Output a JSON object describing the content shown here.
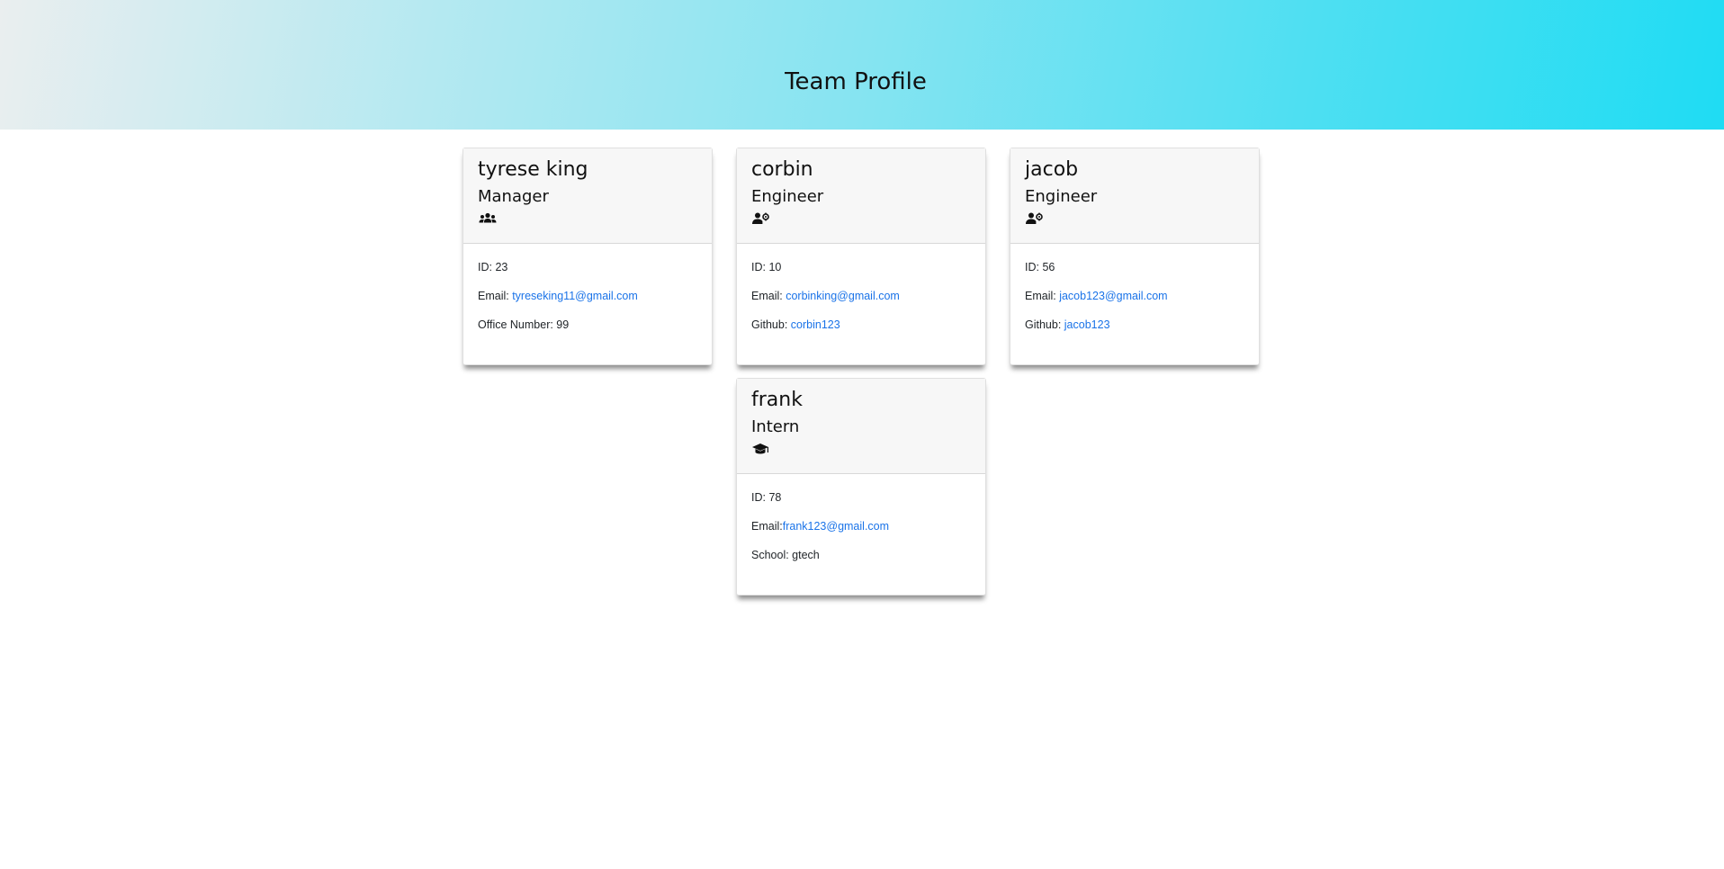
{
  "header": {
    "title": "Team Profile",
    "gradient_start": "#eaeeef",
    "gradient_end": "#1fdcf3"
  },
  "cards": [
    {
      "name": "tyrese king",
      "role": "Manager",
      "icon": "users-icon",
      "id_label": "ID: 23",
      "email_label": "Email: ",
      "email": "tyreseking11@gmail.com",
      "extra_label": "Office Number: 99",
      "extra_link": ""
    },
    {
      "name": "corbin",
      "role": "Engineer",
      "icon": "user-gear-icon",
      "id_label": "ID: 10",
      "email_label": "Email: ",
      "email": "corbinking@gmail.com",
      "extra_label": "Github: ",
      "extra_link": "corbin123"
    },
    {
      "name": "jacob",
      "role": "Engineer",
      "icon": "user-gear-icon",
      "id_label": "ID: 56",
      "email_label": "Email: ",
      "email": "jacob123@gmail.com",
      "extra_label": "Github: ",
      "extra_link": "jacob123"
    },
    {
      "name": "frank",
      "role": "Intern",
      "icon": "graduation-cap-icon",
      "id_label": "ID: 78",
      "email_label": "Email:",
      "email": "frank123@gmail.com",
      "extra_label": "School: gtech",
      "extra_link": ""
    }
  ],
  "link_color": "#1a73e8"
}
